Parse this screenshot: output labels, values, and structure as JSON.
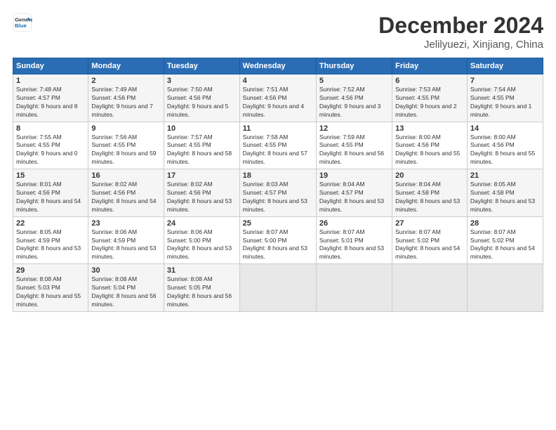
{
  "header": {
    "logo_line1": "General",
    "logo_line2": "Blue",
    "title": "December 2024",
    "subtitle": "Jelilyuezi, Xinjiang, China"
  },
  "weekdays": [
    "Sunday",
    "Monday",
    "Tuesday",
    "Wednesday",
    "Thursday",
    "Friday",
    "Saturday"
  ],
  "weeks": [
    [
      {
        "day": "1",
        "sunrise": "Sunrise: 7:48 AM",
        "sunset": "Sunset: 4:57 PM",
        "daylight": "Daylight: 9 hours and 8 minutes."
      },
      {
        "day": "2",
        "sunrise": "Sunrise: 7:49 AM",
        "sunset": "Sunset: 4:56 PM",
        "daylight": "Daylight: 9 hours and 7 minutes."
      },
      {
        "day": "3",
        "sunrise": "Sunrise: 7:50 AM",
        "sunset": "Sunset: 4:56 PM",
        "daylight": "Daylight: 9 hours and 5 minutes."
      },
      {
        "day": "4",
        "sunrise": "Sunrise: 7:51 AM",
        "sunset": "Sunset: 4:56 PM",
        "daylight": "Daylight: 9 hours and 4 minutes."
      },
      {
        "day": "5",
        "sunrise": "Sunrise: 7:52 AM",
        "sunset": "Sunset: 4:56 PM",
        "daylight": "Daylight: 9 hours and 3 minutes."
      },
      {
        "day": "6",
        "sunrise": "Sunrise: 7:53 AM",
        "sunset": "Sunset: 4:55 PM",
        "daylight": "Daylight: 9 hours and 2 minutes."
      },
      {
        "day": "7",
        "sunrise": "Sunrise: 7:54 AM",
        "sunset": "Sunset: 4:55 PM",
        "daylight": "Daylight: 9 hours and 1 minute."
      }
    ],
    [
      {
        "day": "8",
        "sunrise": "Sunrise: 7:55 AM",
        "sunset": "Sunset: 4:55 PM",
        "daylight": "Daylight: 9 hours and 0 minutes."
      },
      {
        "day": "9",
        "sunrise": "Sunrise: 7:56 AM",
        "sunset": "Sunset: 4:55 PM",
        "daylight": "Daylight: 8 hours and 59 minutes."
      },
      {
        "day": "10",
        "sunrise": "Sunrise: 7:57 AM",
        "sunset": "Sunset: 4:55 PM",
        "daylight": "Daylight: 8 hours and 58 minutes."
      },
      {
        "day": "11",
        "sunrise": "Sunrise: 7:58 AM",
        "sunset": "Sunset: 4:55 PM",
        "daylight": "Daylight: 8 hours and 57 minutes."
      },
      {
        "day": "12",
        "sunrise": "Sunrise: 7:59 AM",
        "sunset": "Sunset: 4:55 PM",
        "daylight": "Daylight: 8 hours and 56 minutes."
      },
      {
        "day": "13",
        "sunrise": "Sunrise: 8:00 AM",
        "sunset": "Sunset: 4:56 PM",
        "daylight": "Daylight: 8 hours and 55 minutes."
      },
      {
        "day": "14",
        "sunrise": "Sunrise: 8:00 AM",
        "sunset": "Sunset: 4:56 PM",
        "daylight": "Daylight: 8 hours and 55 minutes."
      }
    ],
    [
      {
        "day": "15",
        "sunrise": "Sunrise: 8:01 AM",
        "sunset": "Sunset: 4:56 PM",
        "daylight": "Daylight: 8 hours and 54 minutes."
      },
      {
        "day": "16",
        "sunrise": "Sunrise: 8:02 AM",
        "sunset": "Sunset: 4:56 PM",
        "daylight": "Daylight: 8 hours and 54 minutes."
      },
      {
        "day": "17",
        "sunrise": "Sunrise: 8:02 AM",
        "sunset": "Sunset: 4:56 PM",
        "daylight": "Daylight: 8 hours and 53 minutes."
      },
      {
        "day": "18",
        "sunrise": "Sunrise: 8:03 AM",
        "sunset": "Sunset: 4:57 PM",
        "daylight": "Daylight: 8 hours and 53 minutes."
      },
      {
        "day": "19",
        "sunrise": "Sunrise: 8:04 AM",
        "sunset": "Sunset: 4:57 PM",
        "daylight": "Daylight: 8 hours and 53 minutes."
      },
      {
        "day": "20",
        "sunrise": "Sunrise: 8:04 AM",
        "sunset": "Sunset: 4:58 PM",
        "daylight": "Daylight: 8 hours and 53 minutes."
      },
      {
        "day": "21",
        "sunrise": "Sunrise: 8:05 AM",
        "sunset": "Sunset: 4:58 PM",
        "daylight": "Daylight: 8 hours and 53 minutes."
      }
    ],
    [
      {
        "day": "22",
        "sunrise": "Sunrise: 8:05 AM",
        "sunset": "Sunset: 4:59 PM",
        "daylight": "Daylight: 8 hours and 53 minutes."
      },
      {
        "day": "23",
        "sunrise": "Sunrise: 8:06 AM",
        "sunset": "Sunset: 4:59 PM",
        "daylight": "Daylight: 8 hours and 53 minutes."
      },
      {
        "day": "24",
        "sunrise": "Sunrise: 8:06 AM",
        "sunset": "Sunset: 5:00 PM",
        "daylight": "Daylight: 8 hours and 53 minutes."
      },
      {
        "day": "25",
        "sunrise": "Sunrise: 8:07 AM",
        "sunset": "Sunset: 5:00 PM",
        "daylight": "Daylight: 8 hours and 53 minutes."
      },
      {
        "day": "26",
        "sunrise": "Sunrise: 8:07 AM",
        "sunset": "Sunset: 5:01 PM",
        "daylight": "Daylight: 8 hours and 53 minutes."
      },
      {
        "day": "27",
        "sunrise": "Sunrise: 8:07 AM",
        "sunset": "Sunset: 5:02 PM",
        "daylight": "Daylight: 8 hours and 54 minutes."
      },
      {
        "day": "28",
        "sunrise": "Sunrise: 8:07 AM",
        "sunset": "Sunset: 5:02 PM",
        "daylight": "Daylight: 8 hours and 54 minutes."
      }
    ],
    [
      {
        "day": "29",
        "sunrise": "Sunrise: 8:08 AM",
        "sunset": "Sunset: 5:03 PM",
        "daylight": "Daylight: 8 hours and 55 minutes."
      },
      {
        "day": "30",
        "sunrise": "Sunrise: 8:08 AM",
        "sunset": "Sunset: 5:04 PM",
        "daylight": "Daylight: 8 hours and 56 minutes."
      },
      {
        "day": "31",
        "sunrise": "Sunrise: 8:08 AM",
        "sunset": "Sunset: 5:05 PM",
        "daylight": "Daylight: 8 hours and 56 minutes."
      },
      null,
      null,
      null,
      null
    ]
  ]
}
